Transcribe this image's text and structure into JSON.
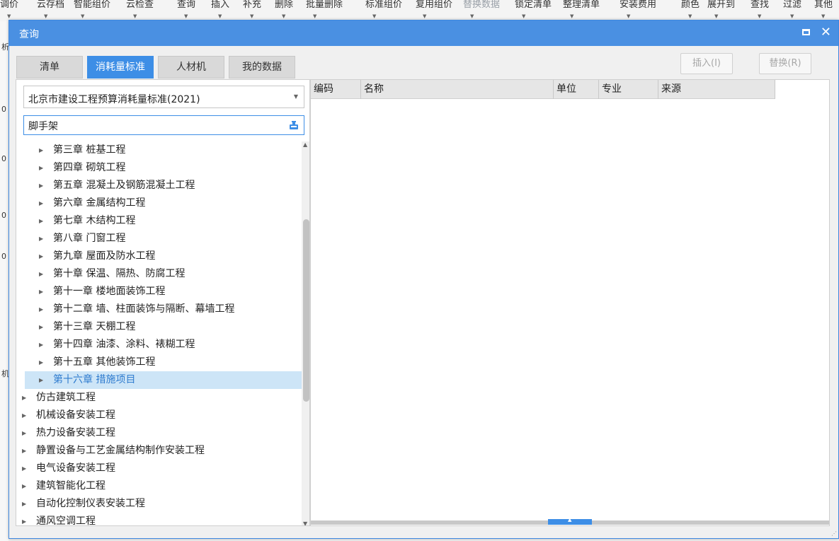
{
  "bg_toolbar": {
    "items": [
      {
        "label": "调价",
        "disabled": false
      },
      {
        "label": "云存档",
        "disabled": false
      },
      {
        "label": "智能组价",
        "disabled": false
      },
      {
        "label": "云检查",
        "disabled": false
      },
      {
        "label": "查询",
        "disabled": false
      },
      {
        "label": "插入",
        "disabled": false
      },
      {
        "label": "补充",
        "disabled": false
      },
      {
        "label": "删除",
        "disabled": false
      },
      {
        "label": "批量删除",
        "disabled": false
      },
      {
        "label": "标准组价",
        "disabled": false
      },
      {
        "label": "复用组价",
        "disabled": false
      },
      {
        "label": "替换数据",
        "disabled": true
      },
      {
        "label": "锁定清单",
        "disabled": false
      },
      {
        "label": "整理清单",
        "disabled": false
      },
      {
        "label": "安装费用",
        "disabled": false
      },
      {
        "label": "颜色",
        "disabled": false
      },
      {
        "label": "展开到",
        "disabled": false
      },
      {
        "label": "查找",
        "disabled": false
      },
      {
        "label": "过滤",
        "disabled": false
      },
      {
        "label": "其他",
        "disabled": false
      }
    ],
    "left_glyphs": [
      "析",
      "0",
      "0",
      "0",
      "0",
      "机"
    ]
  },
  "dialog": {
    "title": "查询",
    "tabs": [
      {
        "label": "清单",
        "active": false
      },
      {
        "label": "消耗量标准",
        "active": true
      },
      {
        "label": "人材机",
        "active": false
      },
      {
        "label": "我的数据",
        "active": false
      }
    ],
    "insert_label": "插入(I)",
    "replace_label": "替换(R)",
    "standard_select": "北京市建设工程预算消耗量标准(2021)",
    "search_value": "脚手架",
    "tree": [
      {
        "label": "第三章 桩基工程",
        "level": 1,
        "selected": false
      },
      {
        "label": "第四章 砌筑工程",
        "level": 1,
        "selected": false
      },
      {
        "label": "第五章 混凝土及钢筋混凝土工程",
        "level": 1,
        "selected": false
      },
      {
        "label": "第六章 金属结构工程",
        "level": 1,
        "selected": false
      },
      {
        "label": "第七章 木结构工程",
        "level": 1,
        "selected": false
      },
      {
        "label": "第八章 门窗工程",
        "level": 1,
        "selected": false
      },
      {
        "label": "第九章 屋面及防水工程",
        "level": 1,
        "selected": false
      },
      {
        "label": "第十章 保温、隔热、防腐工程",
        "level": 1,
        "selected": false
      },
      {
        "label": "第十一章 楼地面装饰工程",
        "level": 1,
        "selected": false
      },
      {
        "label": "第十二章 墙、柱面装饰与隔断、幕墙工程",
        "level": 1,
        "selected": false
      },
      {
        "label": "第十三章 天棚工程",
        "level": 1,
        "selected": false
      },
      {
        "label": "第十四章 油漆、涂料、裱糊工程",
        "level": 1,
        "selected": false
      },
      {
        "label": "第十五章 其他装饰工程",
        "level": 1,
        "selected": false
      },
      {
        "label": "第十六章 措施项目",
        "level": 1,
        "selected": true
      },
      {
        "label": "仿古建筑工程",
        "level": 0,
        "selected": false
      },
      {
        "label": "机械设备安装工程",
        "level": 0,
        "selected": false
      },
      {
        "label": "热力设备安装工程",
        "level": 0,
        "selected": false
      },
      {
        "label": "静置设备与工艺金属结构制作安装工程",
        "level": 0,
        "selected": false
      },
      {
        "label": "电气设备安装工程",
        "level": 0,
        "selected": false
      },
      {
        "label": "建筑智能化工程",
        "level": 0,
        "selected": false
      },
      {
        "label": "自动化控制仪表安装工程",
        "level": 0,
        "selected": false
      },
      {
        "label": "通风空调工程",
        "level": 0,
        "selected": false
      }
    ],
    "columns": [
      "编码",
      "名称",
      "单位",
      "专业",
      "来源"
    ]
  },
  "colors": {
    "accent": "#4a90e2",
    "tab_active": "#3d8ee6",
    "selected_row": "#cde5f7"
  }
}
